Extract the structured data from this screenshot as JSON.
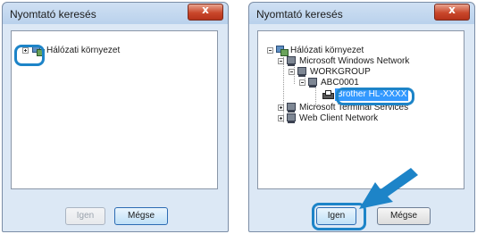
{
  "colors": {
    "highlight": "#1d84c8",
    "selection": "#3399ff"
  },
  "left_dialog": {
    "title": "Nyomtató keresés",
    "close_label": "x",
    "tree": [
      {
        "label": "Hálózati környezet",
        "icon": "network-icon",
        "expander": "plus"
      }
    ],
    "buttons": {
      "ok": "Igen",
      "cancel": "Mégse"
    }
  },
  "right_dialog": {
    "title": "Nyomtató keresés",
    "close_label": "x",
    "tree": [
      {
        "label": "Hálózati környezet",
        "icon": "network-icon",
        "expander": "minus"
      },
      {
        "label": "Microsoft Windows Network",
        "icon": "computer-icon",
        "expander": "minus"
      },
      {
        "label": "WORKGROUP",
        "icon": "computer-icon",
        "expander": "minus"
      },
      {
        "label": "ABC0001",
        "icon": "computer-icon",
        "expander": "minus"
      },
      {
        "label": "Brother HL-XXXX",
        "icon": "printer-icon",
        "selected": true
      },
      {
        "label": "Microsoft Terminal Services",
        "icon": "computer-icon",
        "expander": "plus"
      },
      {
        "label": "Web Client Network",
        "icon": "computer-icon",
        "expander": "plus"
      }
    ],
    "buttons": {
      "ok": "Igen",
      "cancel": "Mégse"
    }
  }
}
